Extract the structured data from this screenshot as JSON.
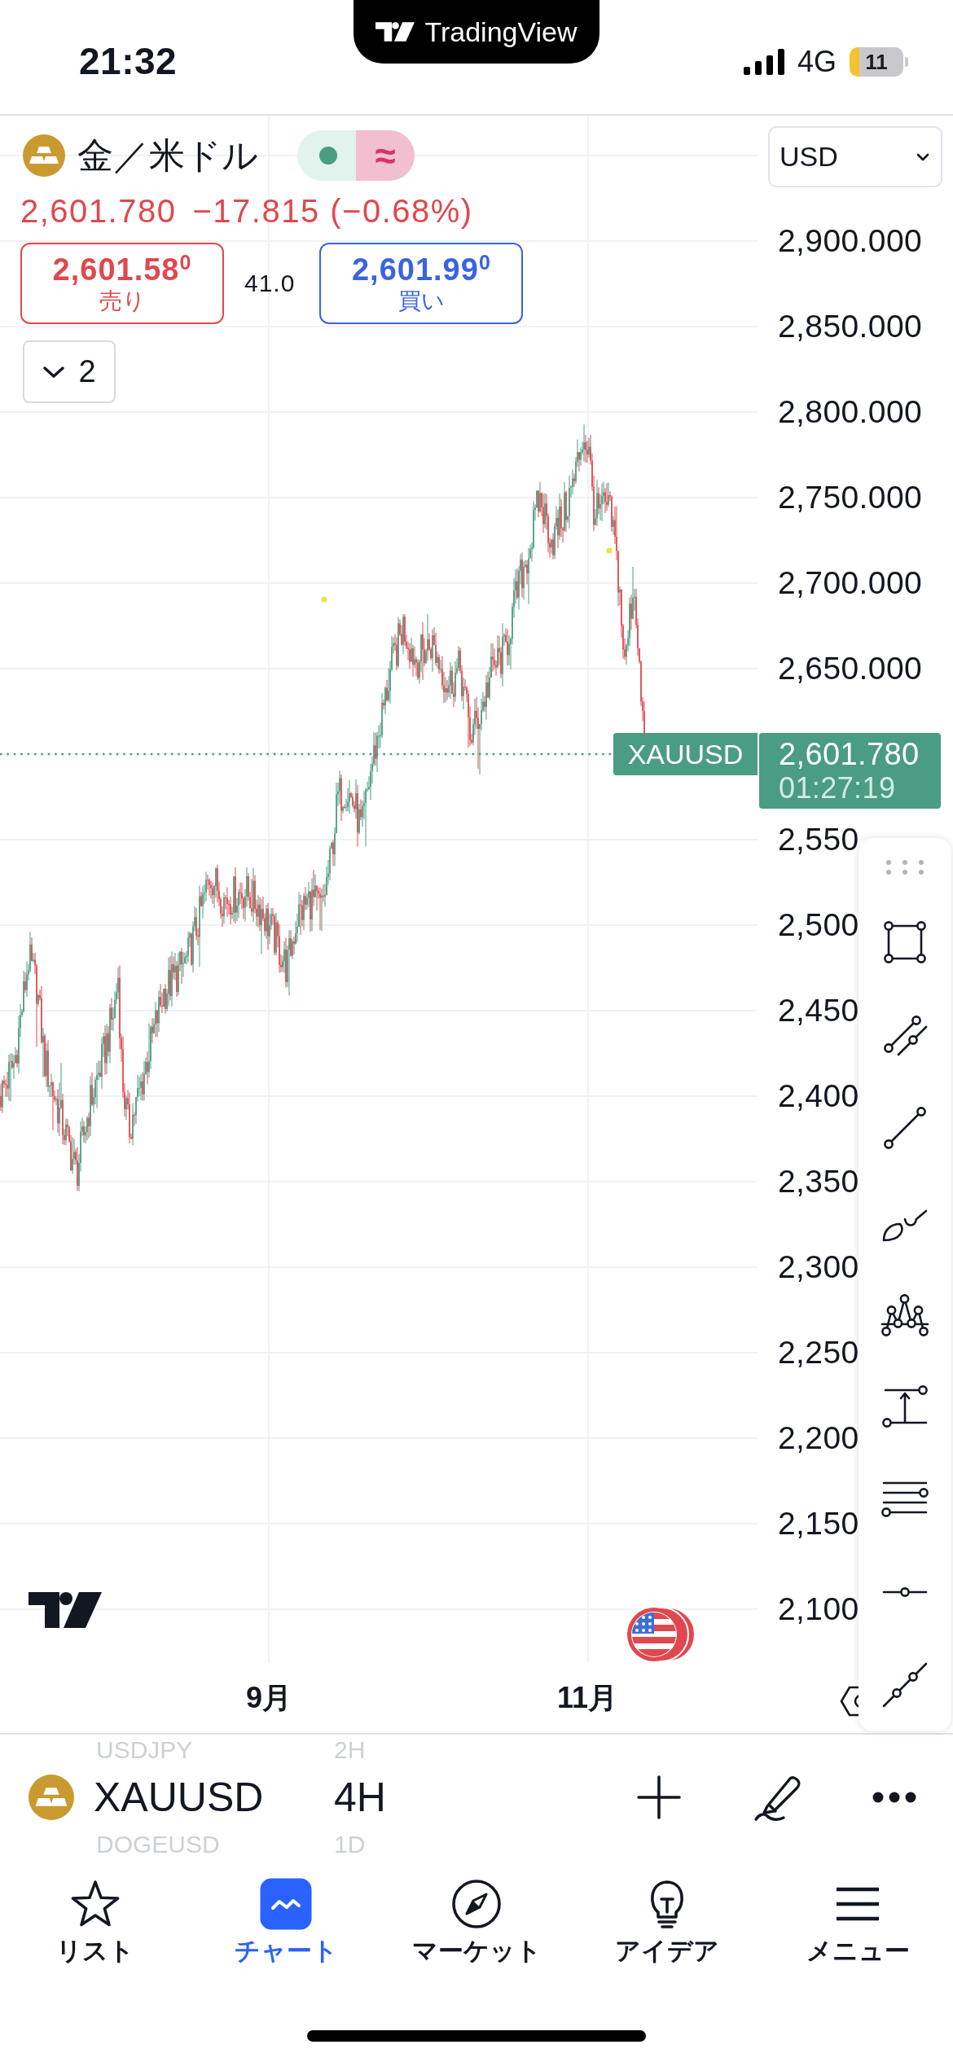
{
  "status_bar": {
    "time": "21:32",
    "network": "4G",
    "battery": "11"
  },
  "banner": {
    "brand": "TradingView"
  },
  "header": {
    "name": "金／米ドル",
    "market_open": true,
    "badge": "≈",
    "last_price": "2,601.780",
    "change": "−17.815 (−0.68%)",
    "price_down": true,
    "sell": {
      "price": "2,601.58$^{0}$",
      "label": "売り"
    },
    "spread": "41.0",
    "buy": {
      "price": "2,601.99$^{0}$",
      "label": "買い"
    },
    "indicator_count": "2"
  },
  "currency_select": {
    "value": "USD"
  },
  "price_axis": [
    {
      "kind": "label",
      "text": "2,900.000"
    },
    {
      "kind": "label",
      "text": "2,850.000"
    },
    {
      "kind": "label",
      "text": "2,800.000"
    },
    {
      "kind": "label",
      "text": "2,750.000"
    },
    {
      "kind": "label",
      "text": "2,700.000"
    },
    {
      "kind": "label",
      "text": "2,650.000"
    },
    {
      "kind": "price_tag",
      "text": "2,601.780",
      "countdown": "01:27:19"
    },
    {
      "kind": "label",
      "text": "2,550"
    },
    {
      "kind": "label",
      "text": "2,500"
    },
    {
      "kind": "label",
      "text": "2,450"
    },
    {
      "kind": "label",
      "text": "2,400"
    },
    {
      "kind": "label",
      "text": "2,350"
    },
    {
      "kind": "label",
      "text": "2,300"
    },
    {
      "kind": "label",
      "text": "2,250"
    },
    {
      "kind": "label",
      "text": "2,200"
    },
    {
      "kind": "label",
      "text": "2,150"
    },
    {
      "kind": "label",
      "text": "2,100"
    }
  ],
  "chart": {
    "symbol_tag": "XAUUSD",
    "time_labels": [
      "9月",
      "11月"
    ]
  },
  "symbol_bar": {
    "previous": {
      "symbol": "USDJPY",
      "interval": "2H"
    },
    "current": {
      "symbol": "XAUUSD",
      "interval": "4H"
    },
    "next": {
      "symbol": "DOGEUSD",
      "interval": "1D"
    }
  },
  "tabs": [
    {
      "label": "リスト",
      "selected": false
    },
    {
      "label": "チャート",
      "selected": true
    },
    {
      "label": "マーケット",
      "selected": false
    },
    {
      "label": "アイデア",
      "selected": false
    },
    {
      "label": "メニュー",
      "selected": false
    }
  ]
}
